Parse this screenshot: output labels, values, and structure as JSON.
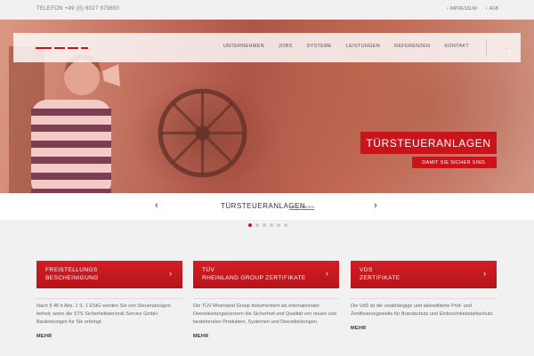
{
  "topbar": {
    "phone": "TELEFON +49 (0) 6027 979850",
    "links": [
      "IMPRESSUM",
      "AGB"
    ]
  },
  "nav": {
    "items": [
      "UNTERNEHMEN",
      "JOBS",
      "SYSTEME",
      "LEISTUNGEN",
      "REFERENZEN",
      "KONTAKT"
    ],
    "extra": "."
  },
  "hero": {
    "title": "TÜRSTEUERANLAGEN",
    "subtitle": "DAMIT SIE SICHER SIND."
  },
  "slider": {
    "prev": "‹",
    "next": "›",
    "title": "TÜRSTEUERANLAGEN",
    "more": "mehr erfahren",
    "dots": 6,
    "active_dot": 0
  },
  "cards": [
    {
      "label_line1": "FREISTELLUNGS",
      "label_line2": "BESCHEINIGUNG",
      "chevron": "›",
      "desc": "Nach § 48 b Abs. 1 S. 1 EStG werden Sie von Steuerabzügen befreit, wenn die STS Sicherheitstechnik Service GmbH Bauleistungen für Sie erbringt.",
      "more": "MEHR"
    },
    {
      "label_line1": "TÜV",
      "label_line2": "RHEINLAND GROUP ZERTIFIKATE",
      "chevron": "›",
      "desc": "Die TÜV Rheinland Group dokumentiert als internationaler Dienstleistungskonzern die Sicherheit und Qualität von neuen und bestehenden Produkten, Systemen und Dienstleistungen.",
      "more": "MEHR"
    },
    {
      "label_line1": "VDS",
      "label_line2": "ZERTIFIKATE",
      "chevron": "›",
      "desc": "Die VdS ist die unabhängige und akkreditierte Prüf- und Zertifizierungsstelle für Brandschutz und Einbruchdiebstahlschutz.",
      "more": "MEHR"
    }
  ],
  "colors": {
    "brand_red": "#c8151c",
    "page_bg": "#f1f1f1"
  }
}
